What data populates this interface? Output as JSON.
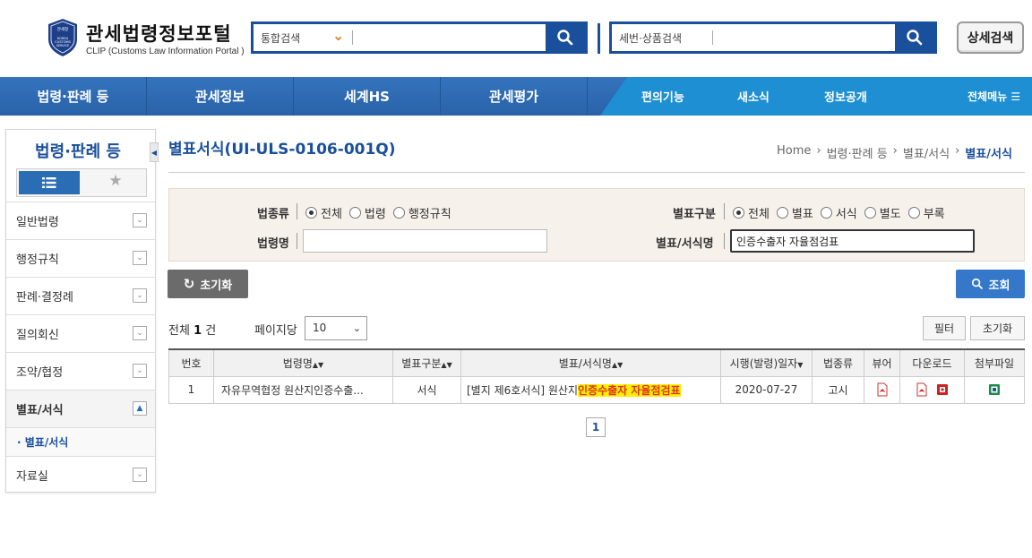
{
  "header": {
    "title": "관세법령정보포털",
    "subtitle": "CLIP (Customs Law Information Portal )",
    "logo_text": "관세청 KOREA CUSTOMS SERVICE",
    "search1_select": "통합검색",
    "search2_select": "세번·상품검색",
    "advanced_search": "상세검색"
  },
  "nav": {
    "main": [
      "법령·판례 등",
      "관세정보",
      "세계HS",
      "관세평가"
    ],
    "sub": [
      "편의기능",
      "새소식",
      "정보공개"
    ],
    "all_menu": "전체메뉴"
  },
  "sidebar": {
    "title": "법령·판례 등",
    "items": [
      {
        "label": "일반법령",
        "active": false
      },
      {
        "label": "행정규칙",
        "active": false
      },
      {
        "label": "판례·결정례",
        "active": false
      },
      {
        "label": "질의회신",
        "active": false
      },
      {
        "label": "조약/협정",
        "active": false
      },
      {
        "label": "별표/서식",
        "active": true
      },
      {
        "label": "자료실",
        "active": false
      }
    ],
    "subitem": "· 별표/서식"
  },
  "main": {
    "title": "별표서식(UI-ULS-0106-001Q)",
    "breadcrumb": [
      "Home",
      "법령·판례 등",
      "별표/서식",
      "별표/서식"
    ]
  },
  "filter": {
    "law_type_label": "법종류",
    "law_type_options": [
      "전체",
      "법령",
      "행정규칙"
    ],
    "annex_label": "별표구분",
    "annex_options": [
      "전체",
      "별표",
      "서식",
      "별도",
      "부록"
    ],
    "law_name_label": "법령명",
    "law_name_value": "",
    "form_name_label": "별표/서식명",
    "form_name_value": "인증수출자 자율점검표"
  },
  "buttons": {
    "reset": "초기화",
    "query": "조회",
    "filter": "필터",
    "reset_small": "초기화"
  },
  "results": {
    "total_prefix": "전체",
    "total_count": "1",
    "total_suffix": "건",
    "per_page_label": "페이지당",
    "per_page_value": "10",
    "columns": [
      "번호",
      "법령명",
      "별표구분",
      "별표/서식명",
      "시행(발령)일자",
      "법종류",
      "뷰어",
      "다운로드",
      "첨부파일"
    ],
    "rows": [
      {
        "no": "1",
        "law_name": "자유무역협정 원산지인증수출...",
        "annex_type": "서식",
        "form_name_prefix": "[별지 제6호서식] 원산지",
        "form_name_highlight": "인증수출자 자율점검표",
        "date": "2020-07-27",
        "law_kind": "고시"
      }
    ],
    "page": "1"
  }
}
